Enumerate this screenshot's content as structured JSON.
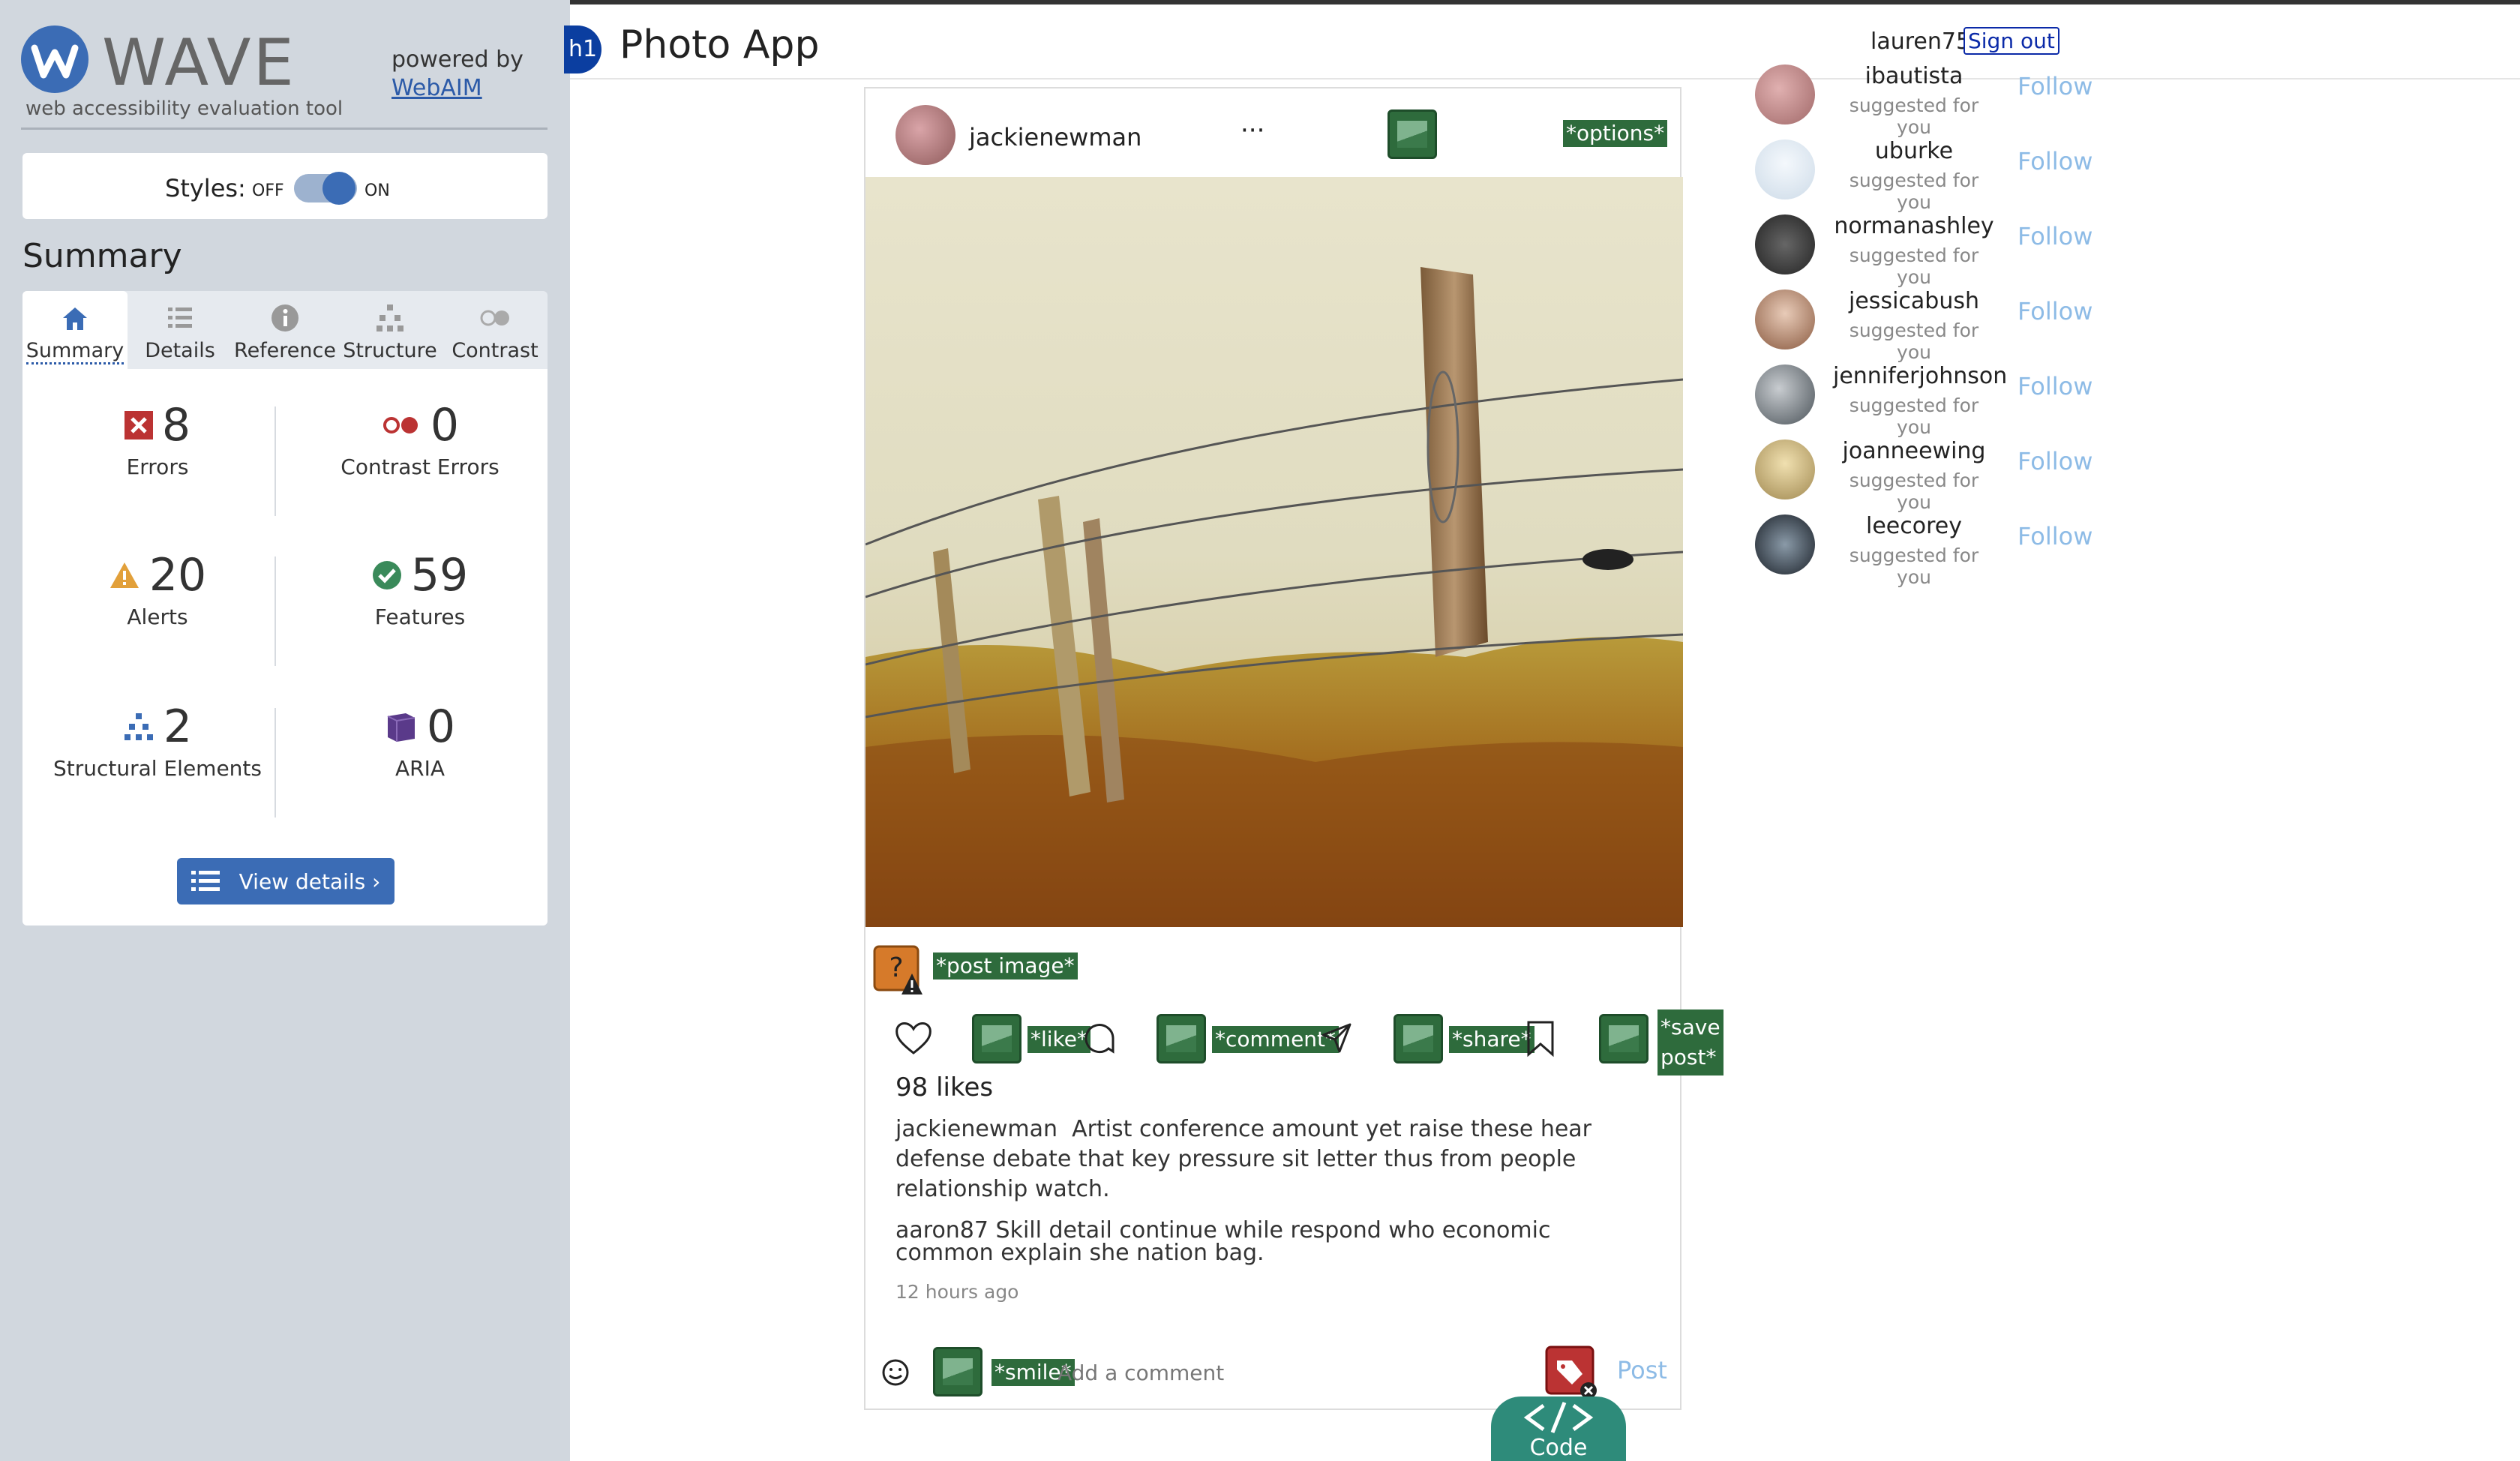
{
  "wave": {
    "title": "WAVE",
    "subtitle": "web accessibility evaluation tool",
    "powered_by": "powered by",
    "webaim": "WebAIM",
    "styles_label": "Styles:",
    "off": "OFF",
    "on": "ON",
    "summary_heading": "Summary",
    "tabs": [
      "Summary",
      "Details",
      "Reference",
      "Structure",
      "Contrast"
    ],
    "stats": {
      "errors": {
        "value": "8",
        "label": "Errors"
      },
      "contrast": {
        "value": "0",
        "label": "Contrast Errors"
      },
      "alerts": {
        "value": "20",
        "label": "Alerts"
      },
      "features": {
        "value": "59",
        "label": "Features"
      },
      "structural": {
        "value": "2",
        "label": "Structural Elements"
      },
      "aria": {
        "value": "0",
        "label": "ARIA"
      }
    },
    "view_details": "View details ›",
    "colors": {
      "accent": "#3b6cb5",
      "error": "#b33",
      "alert": "#e2a03a",
      "feature": "#3a8a5a",
      "aria": "#5a3a8a"
    }
  },
  "app": {
    "h1_badge": "h1",
    "title": "Photo App",
    "user": "lauren75",
    "sign_out": "Sign out"
  },
  "post": {
    "username": "jackienewman",
    "more": "···",
    "options_tag": "*options*",
    "post_image_tag": "*post image*",
    "like_tag": "*like*",
    "comment_tag": "*comment*",
    "share_tag": "*share*",
    "save_tag_1": "*save",
    "save_tag_2": "post*",
    "likes": "98 likes",
    "caption_user": "jackienewman",
    "caption_text": "Artist conference amount yet raise these hear defense debate that key pressure sit letter thus from people relationship watch.",
    "comment_user": "aaron87",
    "comment_text": "Skill detail continue while respond who economic common explain she nation bag.",
    "time_ago": "12 hours ago",
    "smile_tag": "*smile*",
    "add_comment_placeholder": "Add a comment",
    "post_button": "Post"
  },
  "code_button": "Code",
  "suggestions": [
    {
      "name": "ibautista",
      "sub": "suggested for you",
      "follow": "Follow"
    },
    {
      "name": "uburke",
      "sub": "suggested for you",
      "follow": "Follow"
    },
    {
      "name": "normanashley",
      "sub": "suggested for you",
      "follow": "Follow"
    },
    {
      "name": "jessicabush",
      "sub": "suggested for you",
      "follow": "Follow"
    },
    {
      "name": "jenniferjohnson",
      "sub": "suggested for you",
      "follow": "Follow"
    },
    {
      "name": "joanneewing",
      "sub": "suggested for you",
      "follow": "Follow"
    },
    {
      "name": "leecorey",
      "sub": "suggested for you",
      "follow": "Follow"
    }
  ]
}
